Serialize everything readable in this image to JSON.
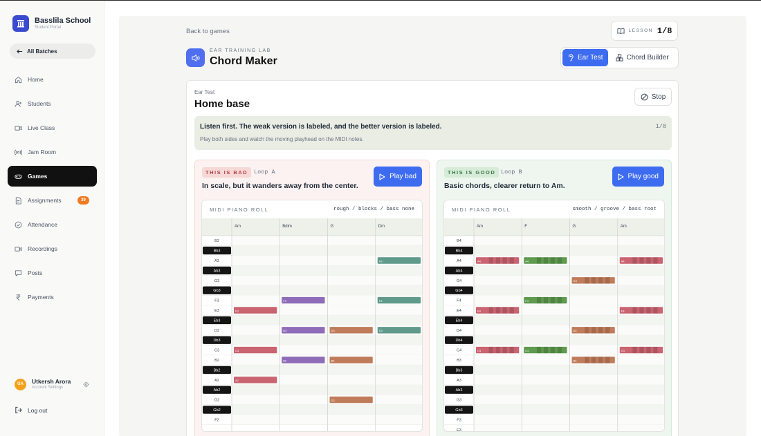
{
  "sidebar": {
    "brand_name": "Basslila School",
    "brand_sub": "Student Portal",
    "batches_label": "All Batches",
    "items": [
      {
        "label": "Home",
        "icon": "home-icon"
      },
      {
        "label": "Students",
        "icon": "students-icon"
      },
      {
        "label": "Live Class",
        "icon": "video-icon"
      },
      {
        "label": "Jam Room",
        "icon": "broadcast-icon"
      },
      {
        "label": "Games",
        "icon": "gamepad-icon",
        "active": true
      },
      {
        "label": "Assignments",
        "icon": "document-icon",
        "badge": "39"
      },
      {
        "label": "Attendance",
        "icon": "check-circle-icon"
      },
      {
        "label": "Recordings",
        "icon": "camera-icon"
      },
      {
        "label": "Posts",
        "icon": "chat-icon"
      },
      {
        "label": "Payments",
        "icon": "rupee-icon"
      }
    ],
    "user": {
      "initials": "UA",
      "name": "Utkersh Arora",
      "sub": "Account Settings"
    },
    "logout_label": "Log out"
  },
  "header": {
    "back_label": "Back to games",
    "lesson_label": "LESSON",
    "lesson_count": "1/8",
    "eyebrow": "EAR TRAINING LAB",
    "title": "Chord Maker",
    "modes": [
      {
        "label": "Ear Test",
        "active": true
      },
      {
        "label": "Chord Builder",
        "active": false
      }
    ]
  },
  "card": {
    "eyebrow": "Ear Test",
    "title": "Home base",
    "stop_label": "Stop",
    "note_strong": "Listen first. The weak version is labeled, and the better version is labeled.",
    "note_sub": "Play both sides and watch the moving playhead on the MIDI notes.",
    "note_count": "1/8"
  },
  "colors": {
    "accent": "#3d6cf0",
    "bad": "#c96470",
    "good": "#5f9a6a",
    "sidebar_active": "#111111",
    "badge": "#f07a23"
  },
  "panels": {
    "bad": {
      "tag": "THIS IS BAD",
      "loop": "Loop A",
      "desc": "In scale, but it wanders away from the center.",
      "play_label": "Play bad",
      "roll_label": "MIDI PIANO ROLL",
      "roll_spec": "rough / blocks / bass none",
      "chords": [
        "Am",
        "Bdim",
        "G",
        "Dm"
      ],
      "rows": [
        "B3",
        "Bb3",
        "A3",
        "Ab3",
        "G3",
        "Gb3",
        "F3",
        "E3",
        "Eb3",
        "D3",
        "Db3",
        "C3",
        "B2",
        "Bb2",
        "A2",
        "Ab2",
        "G2",
        "Gb2",
        "F2"
      ],
      "notes": [
        {
          "pitch": "E3",
          "chord": 0,
          "color": "#c96470",
          "segmented": false
        },
        {
          "pitch": "C3",
          "chord": 0,
          "color": "#c96470",
          "segmented": false
        },
        {
          "pitch": "A2",
          "chord": 0,
          "color": "#c96470",
          "segmented": false
        },
        {
          "pitch": "F3",
          "chord": 1,
          "color": "#8e6cb8",
          "segmented": false
        },
        {
          "pitch": "D3",
          "chord": 1,
          "color": "#8e6cb8",
          "segmented": false
        },
        {
          "pitch": "B2",
          "chord": 1,
          "color": "#8e6cb8",
          "segmented": false
        },
        {
          "pitch": "D3",
          "chord": 2,
          "color": "#c07c5a",
          "segmented": false
        },
        {
          "pitch": "B2",
          "chord": 2,
          "color": "#c07c5a",
          "segmented": false
        },
        {
          "pitch": "G2",
          "chord": 2,
          "color": "#c07c5a",
          "segmented": false
        },
        {
          "pitch": "A3",
          "chord": 3,
          "color": "#5f9a8a",
          "segmented": false
        },
        {
          "pitch": "F3",
          "chord": 3,
          "color": "#5f9a8a",
          "segmented": false
        },
        {
          "pitch": "D3",
          "chord": 3,
          "color": "#5f9a8a",
          "segmented": false
        }
      ]
    },
    "good": {
      "tag": "THIS IS GOOD",
      "loop": "Loop B",
      "desc": "Basic chords, clearer return to Am.",
      "play_label": "Play good",
      "roll_label": "MIDI PIANO ROLL",
      "roll_spec": "smooth / groove / bass root",
      "chords": [
        "Am",
        "F",
        "G",
        "Am"
      ],
      "rows": [
        "B4",
        "Bb4",
        "A4",
        "Ab4",
        "G4",
        "Gb4",
        "F4",
        "E4",
        "Eb4",
        "D4",
        "Db4",
        "C4",
        "B3",
        "Bb3",
        "A3",
        "Ab3",
        "G3",
        "Gb3",
        "F3",
        "E3"
      ],
      "notes": [
        {
          "pitch": "A4",
          "chord": 0,
          "color": "#c96470",
          "segmented": true
        },
        {
          "pitch": "E4",
          "chord": 0,
          "color": "#c96470",
          "segmented": true
        },
        {
          "pitch": "C4",
          "chord": 0,
          "color": "#c96470",
          "segmented": true
        },
        {
          "pitch": "A4",
          "chord": 1,
          "color": "#5f9a4e",
          "segmented": true
        },
        {
          "pitch": "F4",
          "chord": 1,
          "color": "#5f9a4e",
          "segmented": true
        },
        {
          "pitch": "C4",
          "chord": 1,
          "color": "#5f9a4e",
          "segmented": true
        },
        {
          "pitch": "G4",
          "chord": 2,
          "color": "#c07c5a",
          "segmented": true
        },
        {
          "pitch": "D4",
          "chord": 2,
          "color": "#c07c5a",
          "segmented": true
        },
        {
          "pitch": "B3",
          "chord": 2,
          "color": "#c07c5a",
          "segmented": true
        },
        {
          "pitch": "A4",
          "chord": 3,
          "color": "#c96470",
          "segmented": true
        },
        {
          "pitch": "E4",
          "chord": 3,
          "color": "#c96470",
          "segmented": true
        },
        {
          "pitch": "C4",
          "chord": 3,
          "color": "#c96470",
          "segmented": true
        }
      ]
    }
  }
}
